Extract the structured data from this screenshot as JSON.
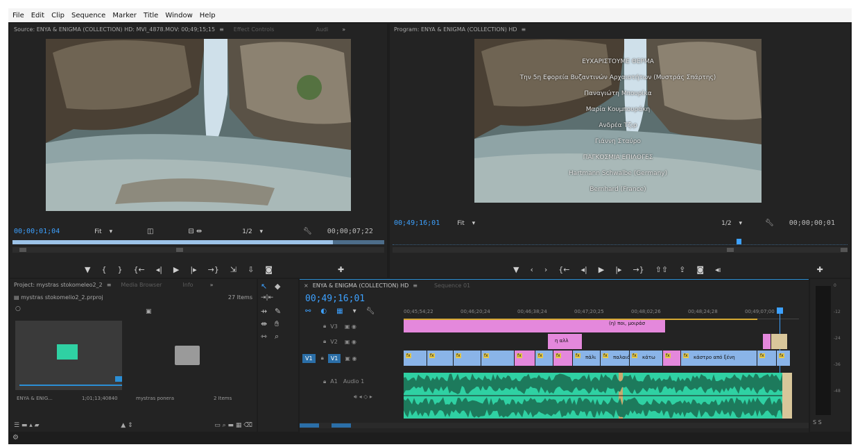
{
  "menu": [
    "File",
    "Edit",
    "Clip",
    "Sequence",
    "Marker",
    "Title",
    "Window",
    "Help"
  ],
  "source": {
    "tab_active": "Source: ENYA & ENIGMA (COLLECTION) HD: MVI_4878.MOV: 00;49;15;15",
    "tab_effects": "Effect Controls",
    "tab_audio": "Audi",
    "timecode": "00;00;01;04",
    "fit": "Fit",
    "resolution": "1/2",
    "duration": "00;00;07;22"
  },
  "program": {
    "tab_active": "Program: ENYA & ENIGMA (COLLECTION) HD",
    "timecode": "00;49;16;01",
    "fit": "Fit",
    "resolution": "1/2",
    "duration": "00;00;00;01",
    "credits": [
      "ΕΥΧΑΡΙΣΤΟΥΜΕ ΘΕΡΜΑ",
      "Την 5η Εφορεία Βυζαντινών Αρχαιοτήτων (Μυστράς Σπάρτης)",
      "Παναγιώτη Μπουρίκα",
      "Μαρία Κουμπουράκη",
      "Ανδρέα Τζιρ",
      "Γιάννη Σταύρο",
      "ΠΑΓΚΟΣΜΙΑ ΕΠΙΛΟΓΕΣ",
      "Hartmann Schwalbe (Germany)",
      "Bernhard (France)"
    ]
  },
  "project": {
    "tab_active": "Project: mystras stokomeleo2_2",
    "tab_media": "Media Browser",
    "tab_info": "Info",
    "file": "mystras stokomelio2_2.prproj",
    "items_count": "27 Items",
    "bins": [
      {
        "name": "ENYA & ENIG...",
        "meta": "1;01;13;40840"
      },
      {
        "name": "mystras ponera",
        "meta": "2 Items"
      }
    ]
  },
  "timeline": {
    "tab_active": "ENYA & ENIGMA (COLLECTION) HD",
    "tab_other": "Sequence 01",
    "timecode": "00;49;16;01",
    "ruler": [
      "00;45;54;22",
      "00;46;20;24",
      "00;46;38;24",
      "00;47;20;25",
      "00;48;02;26",
      "00;48;24;28",
      "00;49;07;00"
    ],
    "tracks": {
      "v3": "V3",
      "v2": "V2",
      "v1": "V1",
      "a1": "A1",
      "a1_name": "Audio 1"
    },
    "clip_labels": {
      "pink_top": "(η) ποι, μοιράσ",
      "pink_mid": "η αλλ",
      "blue_a": "πάλι",
      "blue_b": "παλαιό",
      "blue_c": "κάτω",
      "blue_d": "κάστρο από ξένη"
    }
  },
  "meters": {
    "labels": [
      "0",
      "-12",
      "-24",
      "-36",
      "-48"
    ],
    "solo": "S S"
  },
  "colors": {
    "accent": "#2b8fd6",
    "clip_video": "#8ab4e8",
    "clip_title": "#e488dc",
    "clip_audio": "#2fd1a3"
  }
}
